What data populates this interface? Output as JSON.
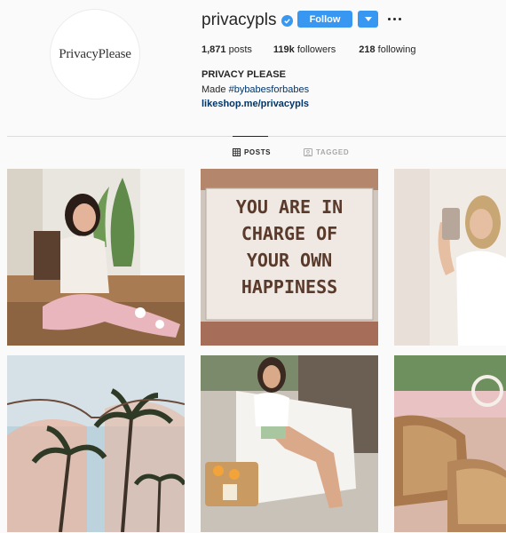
{
  "profile": {
    "avatar_text": "PrivacyPlease",
    "username": "privacypls",
    "verified": true,
    "follow_label": "Follow",
    "stats": {
      "posts_count": "1,871",
      "posts_label": "posts",
      "followers_count": "119k",
      "followers_label": "followers",
      "following_count": "218",
      "following_label": "following"
    },
    "bio_name": "PRIVACY PLEASE",
    "bio_prefix": "Made ",
    "bio_hashtag": "#bybabesforbabes",
    "link": "likeshop.me/privacypls"
  },
  "tabs": [
    {
      "label": "POSTS",
      "icon": "grid-icon",
      "active": true
    },
    {
      "label": "TAGGED",
      "icon": "tag-icon",
      "active": false
    }
  ],
  "posts": [
    {
      "kind": "photo",
      "subject": "woman sitting on floor"
    },
    {
      "kind": "sign",
      "lines": [
        "YOU ARE IN",
        "CHARGE OF",
        "YOUR OWN",
        "HAPPINESS"
      ]
    },
    {
      "kind": "photo",
      "subject": "mirror selfie"
    },
    {
      "kind": "photo",
      "subject": "palm trees through sunglasses"
    },
    {
      "kind": "photo",
      "subject": "woman on lounge chair"
    },
    {
      "kind": "photo",
      "subject": "wicker chairs"
    }
  ],
  "colors": {
    "accent": "#3897f0",
    "link": "#003569",
    "text": "#262626",
    "muted": "#a8a8a8",
    "background": "#fafafa"
  }
}
